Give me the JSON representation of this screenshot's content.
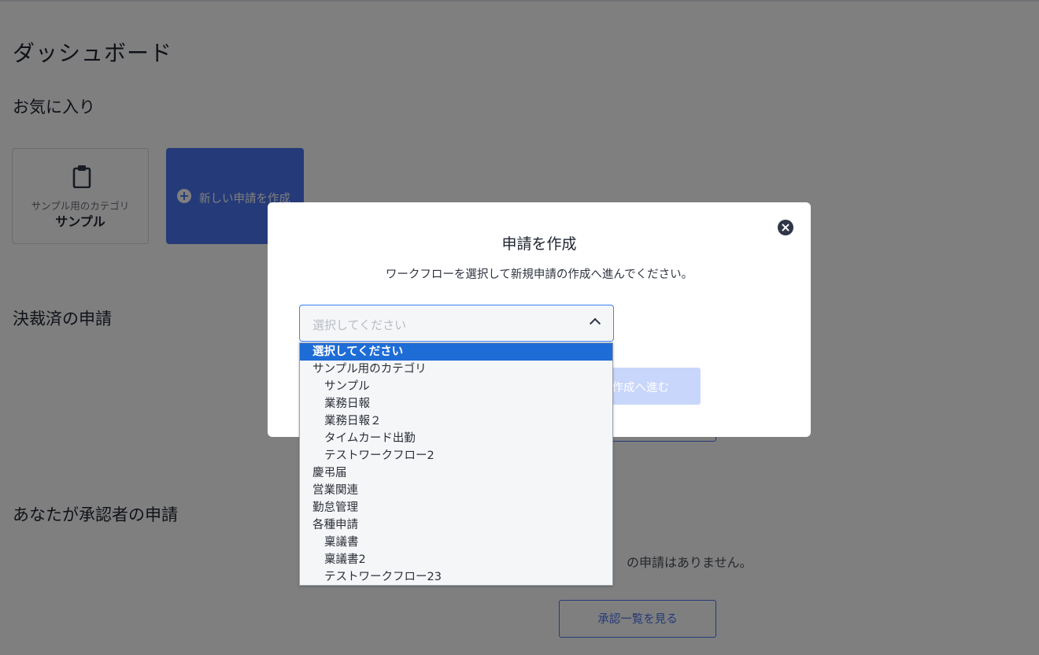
{
  "page": {
    "title": "ダッシュボード",
    "sections": {
      "favorites": "お気に入り",
      "approved": "決裁済の申請",
      "as_approver": "あなたが承認者の申請"
    },
    "favorite_card": {
      "category": "サンプル用のカテゴリ",
      "name": "サンプル",
      "icon": "clipboard-icon"
    },
    "new_request_card": {
      "icon": "plus-circle-icon",
      "label": "新しい申請を作成"
    },
    "empty_approver_text": "の申請はありません。",
    "view_approvals_button": "承認一覧を見る"
  },
  "modal": {
    "title": "申請を作成",
    "description": "ワークフローを選択して新規申請の作成へ進んでください。",
    "close_icon": "close-icon",
    "select": {
      "placeholder": "選択してください",
      "chevron_icon": "chevron-up-icon"
    },
    "proceed_button": "作成へ進む",
    "options": [
      {
        "label": "選択してください",
        "level": 0,
        "selected": true
      },
      {
        "label": "サンプル用のカテゴリ",
        "level": 0,
        "selected": false
      },
      {
        "label": "サンプル",
        "level": 1,
        "selected": false
      },
      {
        "label": "業務日報",
        "level": 1,
        "selected": false
      },
      {
        "label": "業務日報２",
        "level": 1,
        "selected": false
      },
      {
        "label": "タイムカード出勤",
        "level": 1,
        "selected": false
      },
      {
        "label": "テストワークフロー2",
        "level": 1,
        "selected": false
      },
      {
        "label": "慶弔届",
        "level": 0,
        "selected": false
      },
      {
        "label": "営業関連",
        "level": 0,
        "selected": false
      },
      {
        "label": "勤怠管理",
        "level": 0,
        "selected": false
      },
      {
        "label": "各種申請",
        "level": 0,
        "selected": false
      },
      {
        "label": "稟議書",
        "level": 1,
        "selected": false
      },
      {
        "label": "稟議書2",
        "level": 1,
        "selected": false
      },
      {
        "label": "テストワークフロー23",
        "level": 1,
        "selected": false
      }
    ]
  },
  "colors": {
    "primary": "#4a74f0",
    "selected_option": "#1e6cd6",
    "overlay": "rgba(0,0,0,0.5)"
  }
}
